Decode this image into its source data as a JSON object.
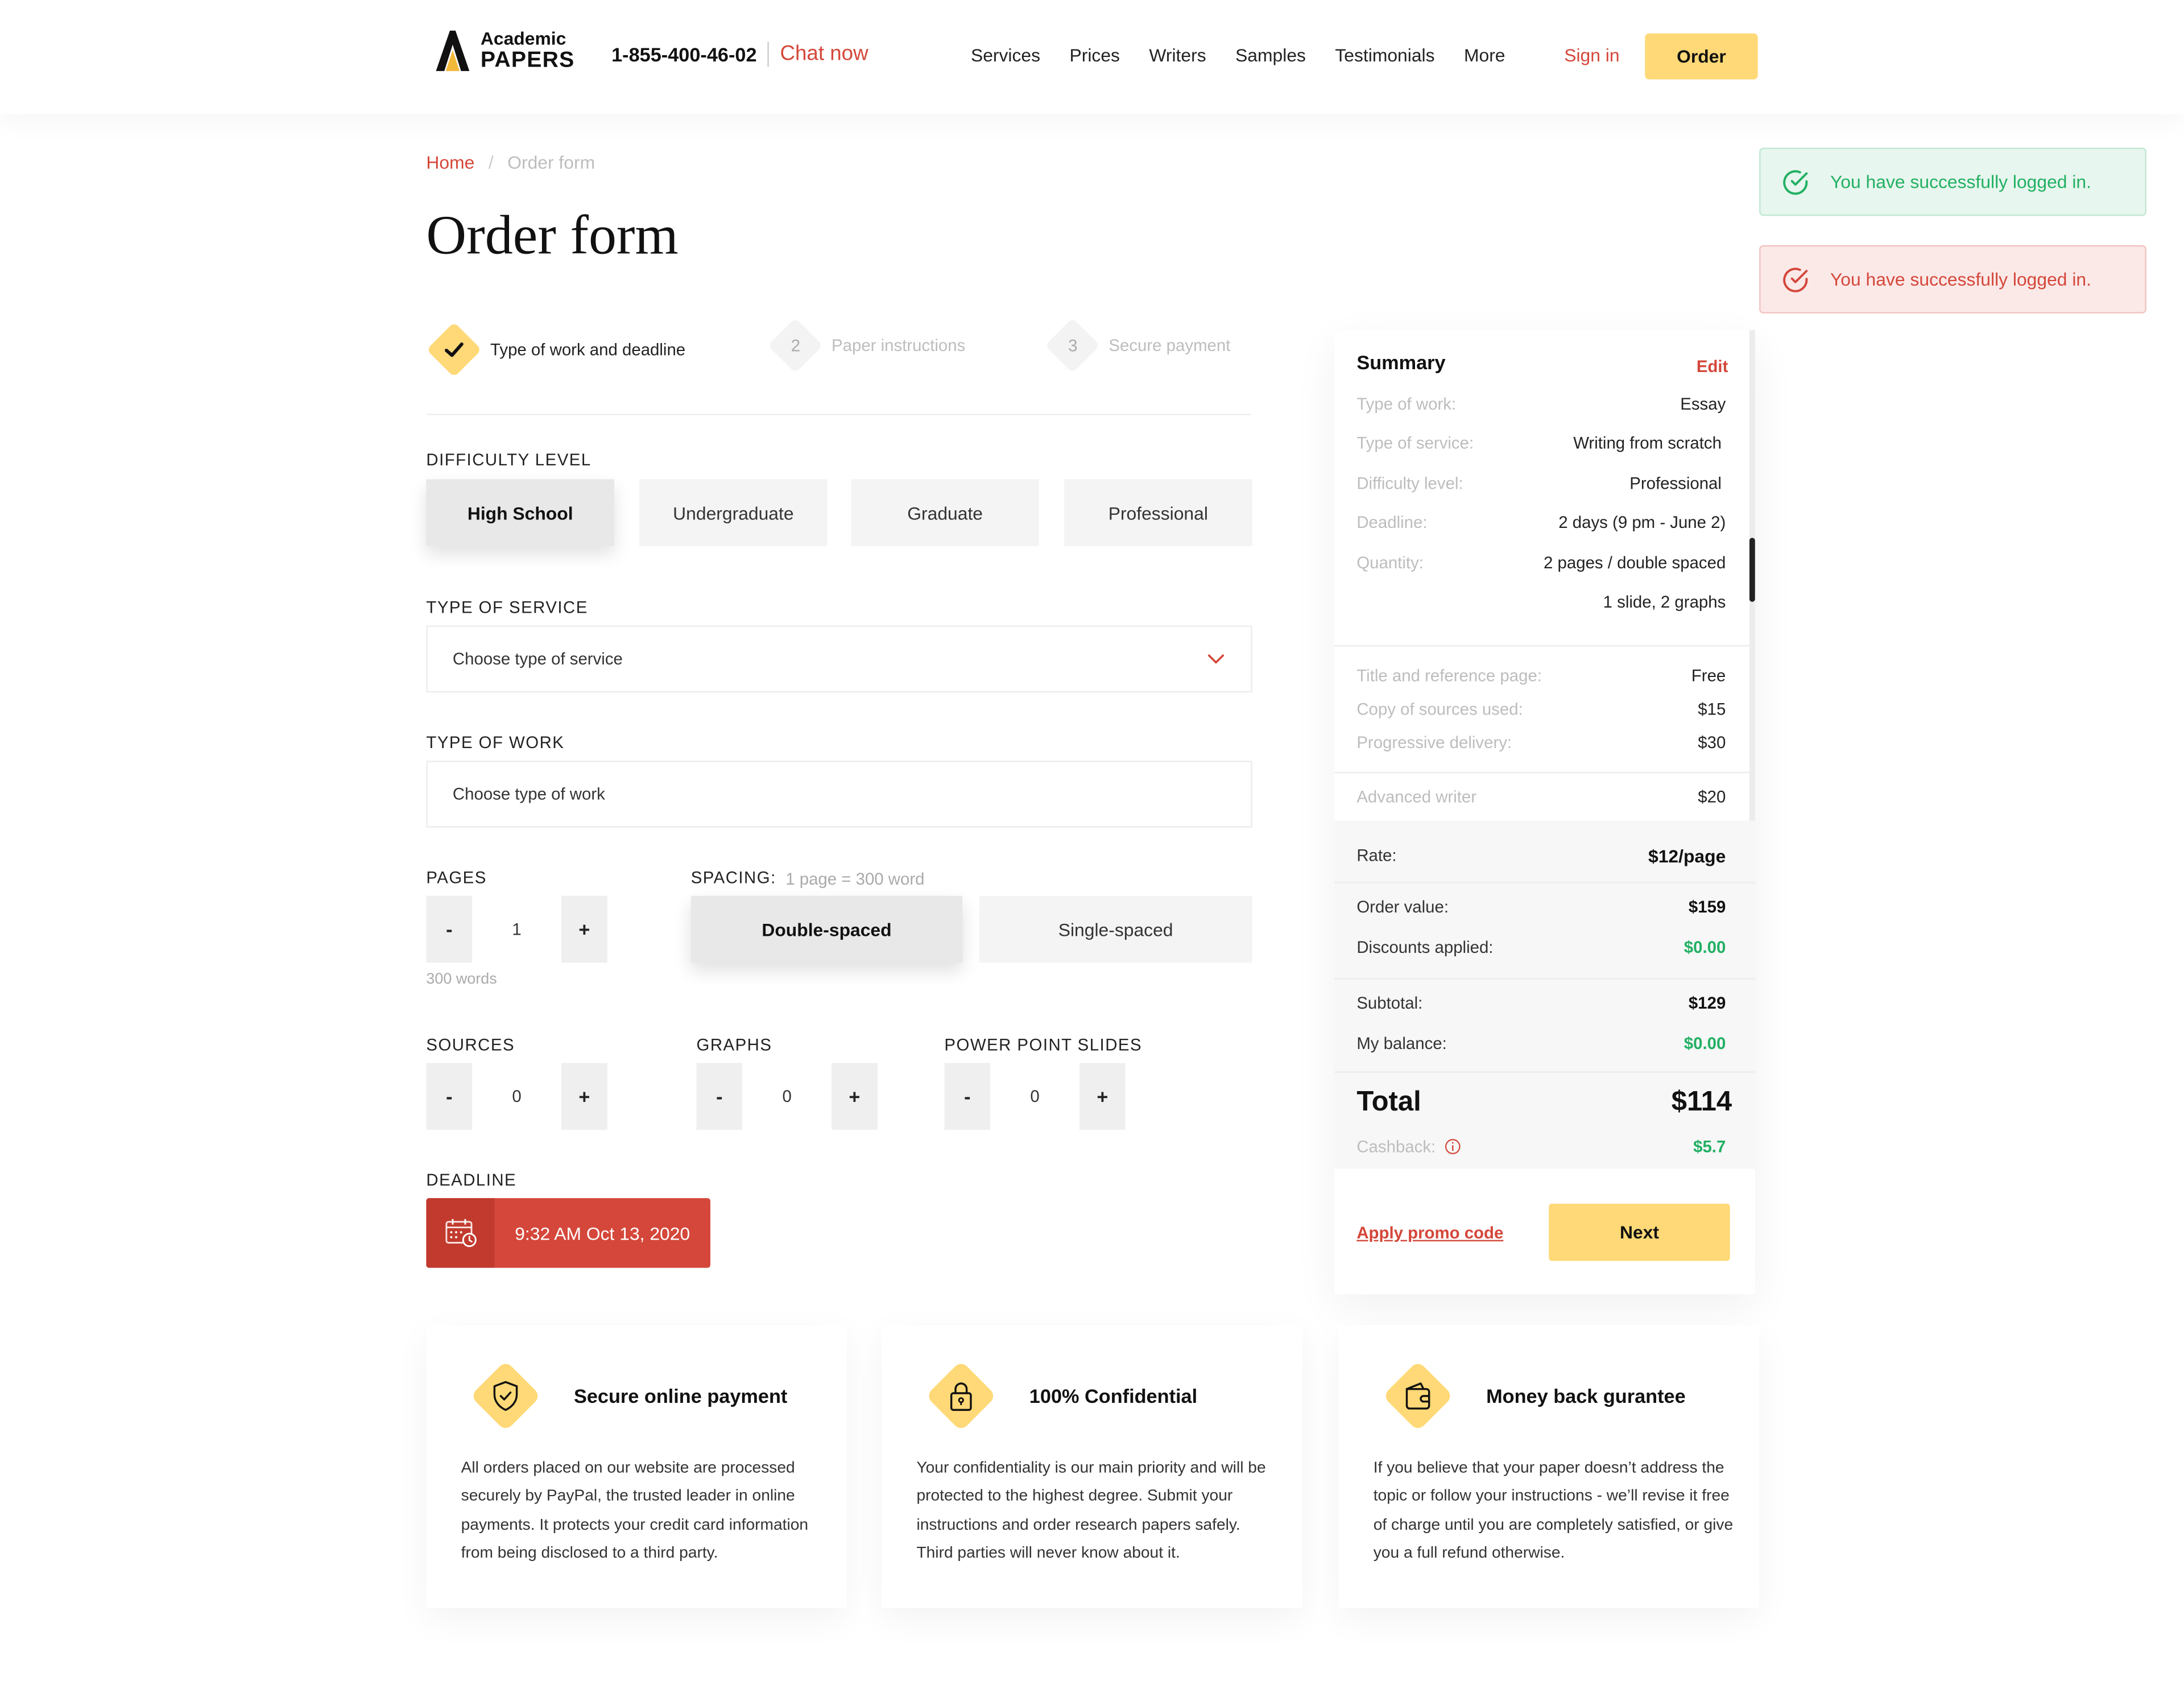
{
  "header": {
    "logo_top": "Academic",
    "logo_bottom": "PAPERS",
    "phone": "1-855-400-46-02",
    "chat": "Chat now",
    "nav": [
      "Services",
      "Prices",
      "Writers",
      "Samples",
      "Testimonials",
      "More"
    ],
    "signin": "Sign in",
    "order": "Order"
  },
  "toasts": {
    "success": "You have successfully logged in.",
    "error": "You have successfully logged in."
  },
  "breadcrumb": {
    "home": "Home",
    "sep": "/",
    "current": "Order form"
  },
  "title": "Order form",
  "steps": [
    {
      "num": "",
      "label": "Type of work and deadline"
    },
    {
      "num": "2",
      "label": "Paper instructions"
    },
    {
      "num": "3",
      "label": "Secure payment"
    }
  ],
  "difficulty": {
    "label": "DIFFICULTY LEVEL",
    "options": [
      "High School",
      "Undergraduate",
      "Graduate",
      "Professional"
    ],
    "selected": "High School"
  },
  "service": {
    "label": "TYPE OF SERVICE",
    "placeholder": "Choose type of service"
  },
  "work": {
    "label": "TYPE OF WORK",
    "placeholder": "Choose type of work"
  },
  "pages": {
    "label": "PAGES",
    "value": "1",
    "hint": "300 words",
    "minus": "-",
    "plus": "+"
  },
  "spacing": {
    "label": "SPACING:",
    "hint": "1 page = 300 word",
    "options": [
      "Double-spaced",
      "Single-spaced"
    ],
    "selected": "Double-spaced"
  },
  "sources": {
    "label": "SOURCES",
    "value": "0"
  },
  "graphs": {
    "label": "GRAPHS",
    "value": "0"
  },
  "slides": {
    "label": "POWER POINT SLIDES",
    "value": "0"
  },
  "deadline": {
    "label": "DEADLINE",
    "value": "9:32 AM Oct 13, 2020"
  },
  "summary": {
    "title": "Summary",
    "edit": "Edit",
    "rows": [
      {
        "k": "Type of work:",
        "v": "Essay"
      },
      {
        "k": "Type of service:",
        "v": "Writing from scratch"
      },
      {
        "k": "Difficulty level:",
        "v": "Professional"
      },
      {
        "k": "Deadline:",
        "v": "2 days (9 pm - June 2)"
      },
      {
        "k": "Quantity:",
        "v": "2 pages / double spaced"
      },
      {
        "k": "",
        "v": "1 slide, 2 graphs"
      }
    ],
    "extras": [
      {
        "k": "Title and reference page:",
        "v": "Free"
      },
      {
        "k": "Copy of sources used:",
        "v": "$15"
      },
      {
        "k": "Progressive delivery:",
        "v": "$30"
      },
      {
        "k": "Advanced writer",
        "v": "$20"
      }
    ],
    "rate": {
      "k": "Rate:",
      "v": "$12/page"
    },
    "order_value": {
      "k": "Order value:",
      "v": "$159"
    },
    "discounts": {
      "k": "Discounts applied:",
      "v": "$0.00"
    },
    "subtotal": {
      "k": "Subtotal:",
      "v": "$129"
    },
    "balance": {
      "k": "My balance:",
      "v": "$0.00"
    },
    "total": {
      "k": "Total",
      "v": "$114"
    },
    "cashback": {
      "k": "Cashback:",
      "v": "$5.7"
    },
    "promo": "Apply promo code",
    "next": "Next"
  },
  "features": [
    {
      "title": "Secure online payment",
      "text": "All orders placed on our website are processed securely by PayPal, the trusted leader in online payments. It protects your credit card information from being disclosed to a third party."
    },
    {
      "title": "100% Confidential",
      "text": "Your confidentiality is our main priority and will be protected to the highest degree. Submit your instructions and order research papers safely. Third parties will never know about it."
    },
    {
      "title": "Money back gurantee",
      "text": "If you believe that your paper doesn’t address the topic or follow your instructions - we’ll revise it free of charge until you are completely satisfied, or give you a full refund otherwise."
    }
  ],
  "colors": {
    "accent": "#ffd977",
    "brand_red": "#d4473a",
    "success": "#22b063"
  },
  "icons": [
    "logo-icon",
    "check-icon",
    "chevron-down-icon",
    "calendar-icon",
    "shield-icon",
    "lock-icon",
    "wallet-icon",
    "info-icon",
    "check-circle-icon"
  ]
}
